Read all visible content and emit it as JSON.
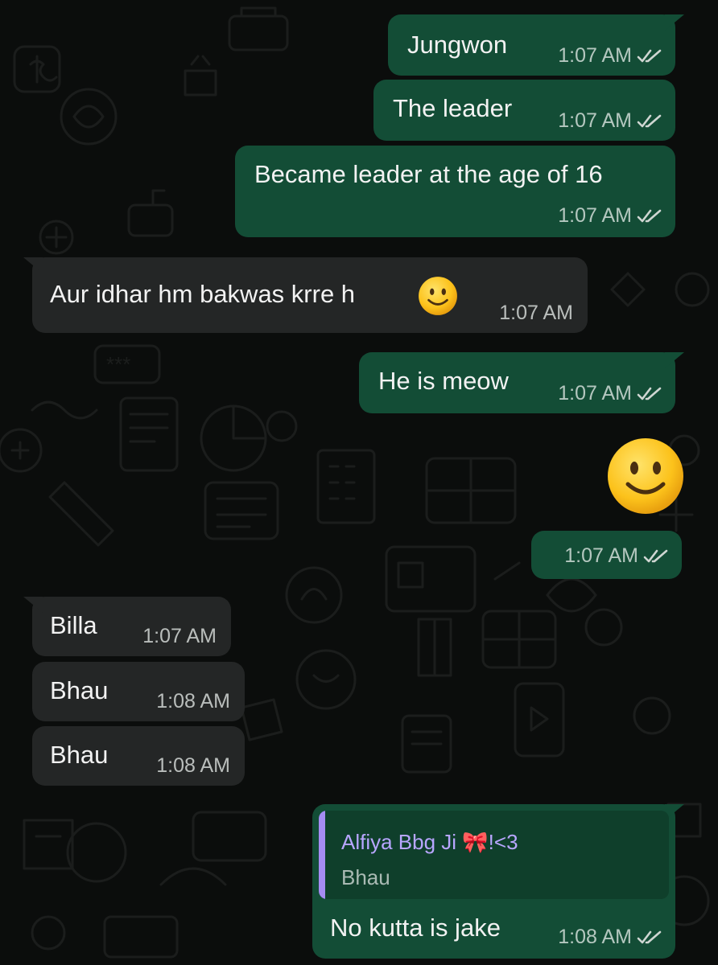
{
  "messages": [
    {
      "direction": "outgoing",
      "text": "Jungwon",
      "time": "1:07 AM",
      "status": "read"
    },
    {
      "direction": "outgoing",
      "text": "The leader",
      "time": "1:07 AM",
      "status": "read"
    },
    {
      "direction": "outgoing",
      "text": "Became leader at the age of 16",
      "time": "1:07 AM",
      "status": "read"
    },
    {
      "direction": "incoming",
      "text": "Aur idhar hm bakwas krre h",
      "emoji": "slightly-smiling-face",
      "time": "1:07 AM"
    },
    {
      "direction": "outgoing",
      "text": "He is meow",
      "time": "1:07 AM",
      "status": "read"
    },
    {
      "direction": "outgoing",
      "emoji": "slightly-smiling-face",
      "time": "1:07 AM",
      "status": "read"
    },
    {
      "direction": "incoming",
      "text": "Billa",
      "time": "1:07 AM"
    },
    {
      "direction": "incoming",
      "text": "Bhau",
      "time": "1:08 AM"
    },
    {
      "direction": "incoming",
      "text": "Bhau",
      "time": "1:08 AM"
    },
    {
      "direction": "outgoing",
      "quoted": {
        "author": "Alfiya Bbg Ji 🎀!<3",
        "text": "Bhau"
      },
      "text": "No kutta is jake",
      "time": "1:08 AM",
      "status": "read"
    }
  ],
  "colors": {
    "outgoing_bubble": "#134d36",
    "incoming_bubble": "#242626",
    "background": "#0b0d0c",
    "quote_accent": "#a58bf2",
    "quote_author": "#b8a6ff"
  },
  "icons": {
    "read_receipt": "double-check-icon",
    "emoji": "slightly-smiling-face-icon"
  }
}
